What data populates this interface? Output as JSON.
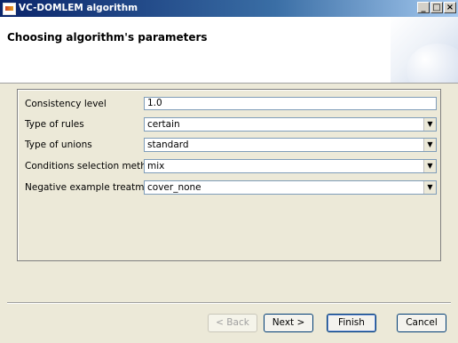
{
  "window": {
    "title": "VC-DOMLEM algorithm",
    "minimize_glyph": "_",
    "maximize_glyph": "□",
    "close_glyph": "×"
  },
  "header": {
    "title": "Choosing algorithm's parameters"
  },
  "parameters": [
    {
      "label": "Consistency level",
      "kind": "text",
      "value": "1.0"
    },
    {
      "label": "Type of rules",
      "kind": "combo",
      "value": "certain"
    },
    {
      "label": "Type of unions",
      "kind": "combo",
      "value": "standard"
    },
    {
      "label": "Conditions selection method",
      "kind": "combo",
      "value": "mix"
    },
    {
      "label": "Negative example treatment",
      "kind": "combo",
      "value": "cover_none"
    }
  ],
  "buttons": {
    "back": "< Back",
    "next": "Next >",
    "finish": "Finish",
    "cancel": "Cancel"
  },
  "icons": {
    "combo_arrow": "chevron-down-icon",
    "app": "app-icon"
  },
  "colors": {
    "title_bar": "#0a246a",
    "dialog_bg": "#ece9d8",
    "field_border": "#7f9db9"
  }
}
